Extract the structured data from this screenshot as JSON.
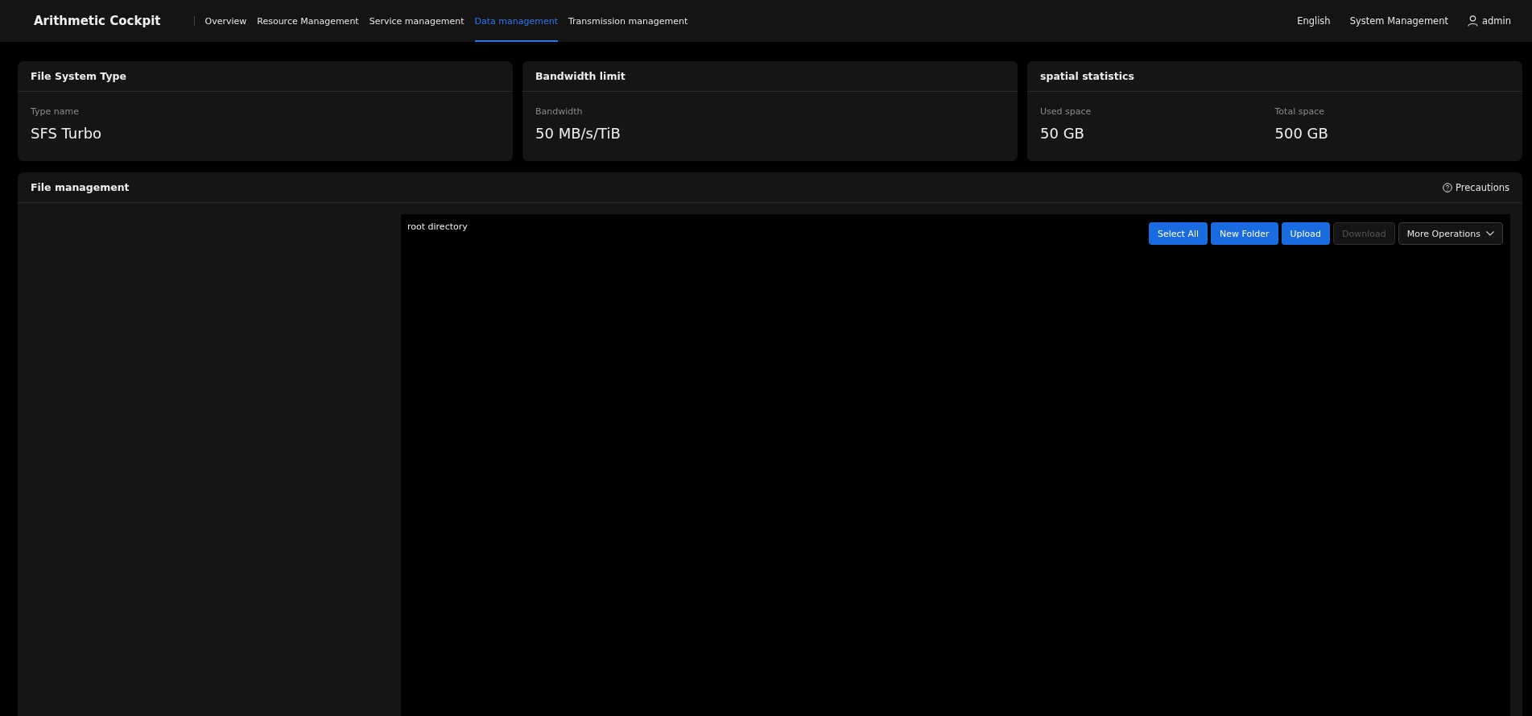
{
  "app_title": "Arithmetic Cockpit",
  "nav": [
    {
      "label": "Overview",
      "selected": false
    },
    {
      "label": "Resource Management",
      "selected": false
    },
    {
      "label": "Service management",
      "selected": false
    },
    {
      "label": "Data management",
      "selected": true
    },
    {
      "label": "Transmission management",
      "selected": false
    }
  ],
  "header_right": {
    "language": "English",
    "system": "System Management",
    "user": "admin"
  },
  "cards": [
    {
      "title": "File System Type",
      "stats": [
        {
          "label": "Type name",
          "value": "SFS Turbo"
        }
      ]
    },
    {
      "title": "Bandwidth limit",
      "stats": [
        {
          "label": "Bandwidth",
          "value": "50 MB/s/TiB"
        }
      ]
    },
    {
      "title": "spatial statistics",
      "stats": [
        {
          "label": "Used space",
          "value": "50 GB"
        },
        {
          "label": "Total space",
          "value": "500 GB"
        }
      ]
    }
  ],
  "file_management": {
    "title": "File management",
    "help_link": "Precautions",
    "path": "root directory",
    "buttons": [
      {
        "label": "Select All",
        "kind": "primary",
        "disabled": false
      },
      {
        "label": "New Folder",
        "kind": "primary",
        "disabled": false
      },
      {
        "label": "Upload",
        "kind": "primary",
        "disabled": false
      },
      {
        "label": "Download",
        "kind": "default",
        "disabled": true
      },
      {
        "label": "More Operations",
        "kind": "dropdown",
        "disabled": false
      }
    ]
  }
}
